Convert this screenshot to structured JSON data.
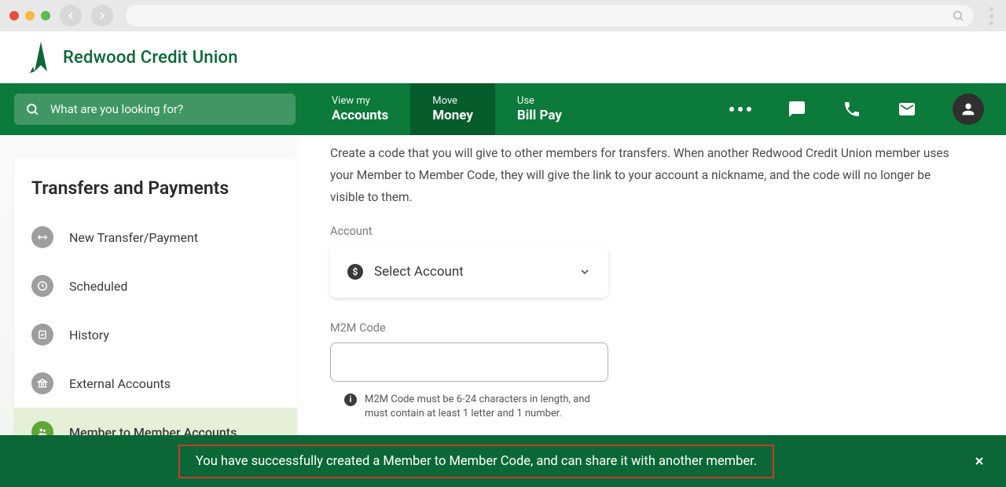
{
  "logo": {
    "text": "Redwood Credit Union"
  },
  "search": {
    "placeholder": "What are you looking for?"
  },
  "nav": {
    "items": [
      {
        "sub": "View my",
        "main": "Accounts"
      },
      {
        "sub": "Move",
        "main": "Money"
      },
      {
        "sub": "Use",
        "main": "Bill Pay"
      }
    ]
  },
  "sidebar": {
    "title": "Transfers and Payments",
    "items": [
      {
        "label": "New Transfer/Payment"
      },
      {
        "label": "Scheduled"
      },
      {
        "label": "History"
      },
      {
        "label": "External Accounts"
      },
      {
        "label": "Member to Member Accounts"
      }
    ]
  },
  "content": {
    "description": "Create a code that you will give to other members for transfers. When another Redwood Credit Union member uses your Member to Member Code, they will give the link to your account a nickname, and the code will no longer be visible to them.",
    "account_label": "Account",
    "select_placeholder": "Select Account",
    "m2m_label": "M2M Code",
    "m2m_hint": "M2M Code must be 6-24 characters in length, and must contain at least 1 letter and 1 number."
  },
  "toast": {
    "message": "You have successfully created a Member to Member Code, and can share it with another member."
  }
}
